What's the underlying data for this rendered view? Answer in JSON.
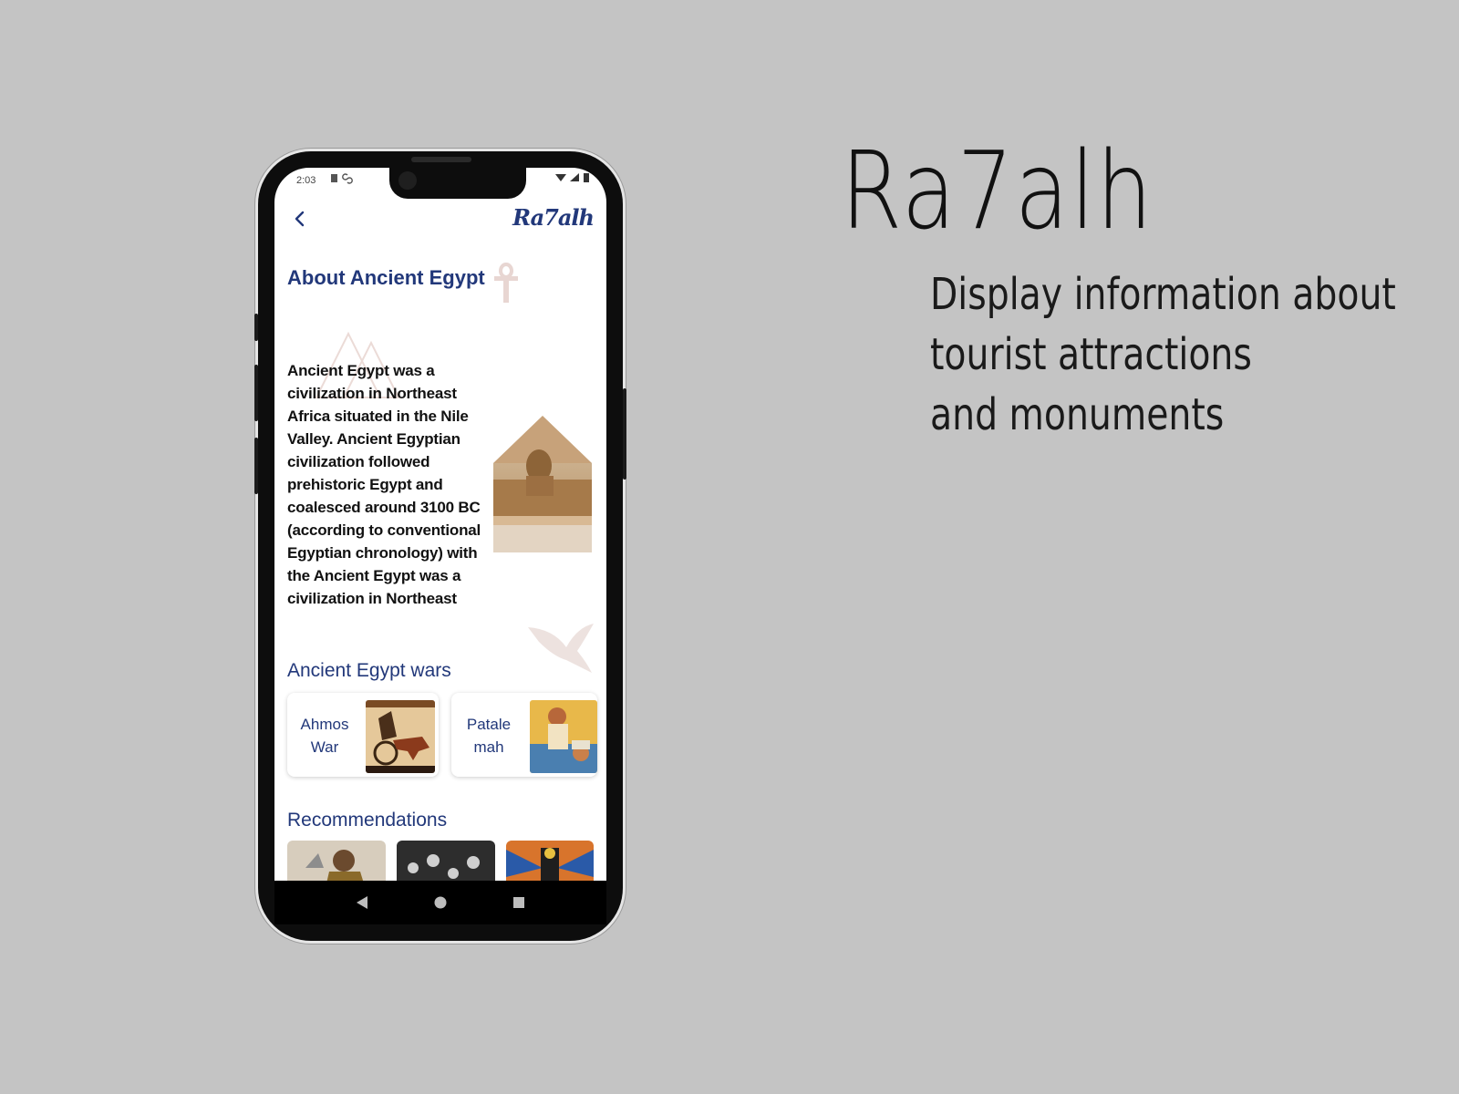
{
  "promo": {
    "title": "Ra7alh",
    "desc_line1": "Display information about",
    "desc_line2": "tourist attractions",
    "desc_line3": "and monuments"
  },
  "status": {
    "time": "2:03"
  },
  "header": {
    "logo": "Ra7alh",
    "back_icon": "chevron-left-icon"
  },
  "about": {
    "title": "About Ancient Egypt",
    "text": "Ancient Egypt was a civilization in Northeast Africa situated in the Nile Valley. Ancient Egyptian civilization followed prehistoric Egypt and coalesced around 3100 BC (according to conventional Egyptian chronology) with the Ancient Egypt was a civilization in Northeast"
  },
  "wars": {
    "title": "Ancient Egypt wars",
    "items": [
      {
        "line1": "Ahmos",
        "line2": "War"
      },
      {
        "line1": "Patale",
        "line2": "mah"
      }
    ]
  },
  "recommendations": {
    "title": "Recommendations"
  },
  "colors": {
    "brand": "#22387a",
    "background": "#c4c4c4"
  }
}
